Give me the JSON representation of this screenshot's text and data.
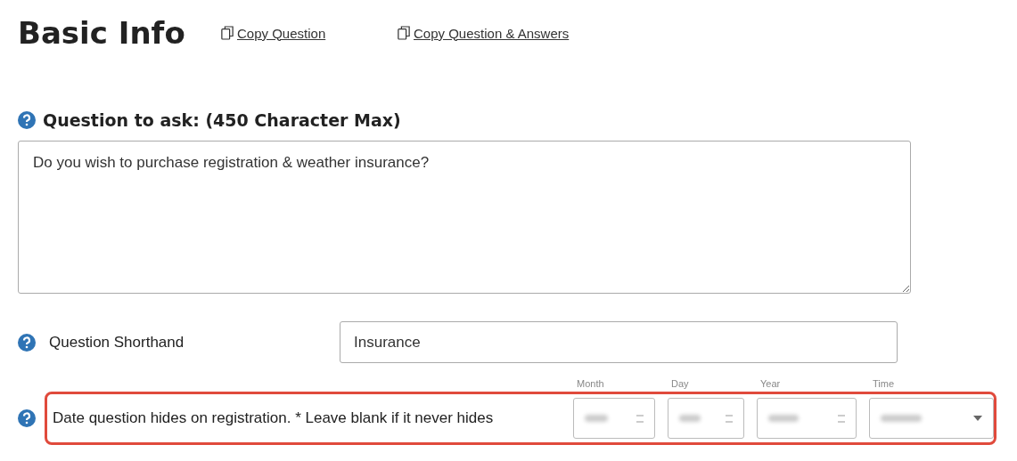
{
  "title": "Basic Info",
  "links": [
    {
      "label": "Copy Question"
    },
    {
      "label": "Copy Question & Answers"
    }
  ],
  "question": {
    "label": "Question to ask: (450 Character Max)",
    "value": "Do you wish to purchase registration & weather insurance?"
  },
  "shorthand": {
    "label": "Question Shorthand",
    "value": "Insurance"
  },
  "hide_date": {
    "label": "Date question hides on registration. * Leave blank if it never hides",
    "highlighted": true,
    "fields": [
      {
        "label": "Month",
        "kind": "spin"
      },
      {
        "label": "Day",
        "kind": "spin"
      },
      {
        "label": "Year",
        "kind": "spin"
      },
      {
        "label": "Time",
        "kind": "dropdown"
      }
    ]
  }
}
